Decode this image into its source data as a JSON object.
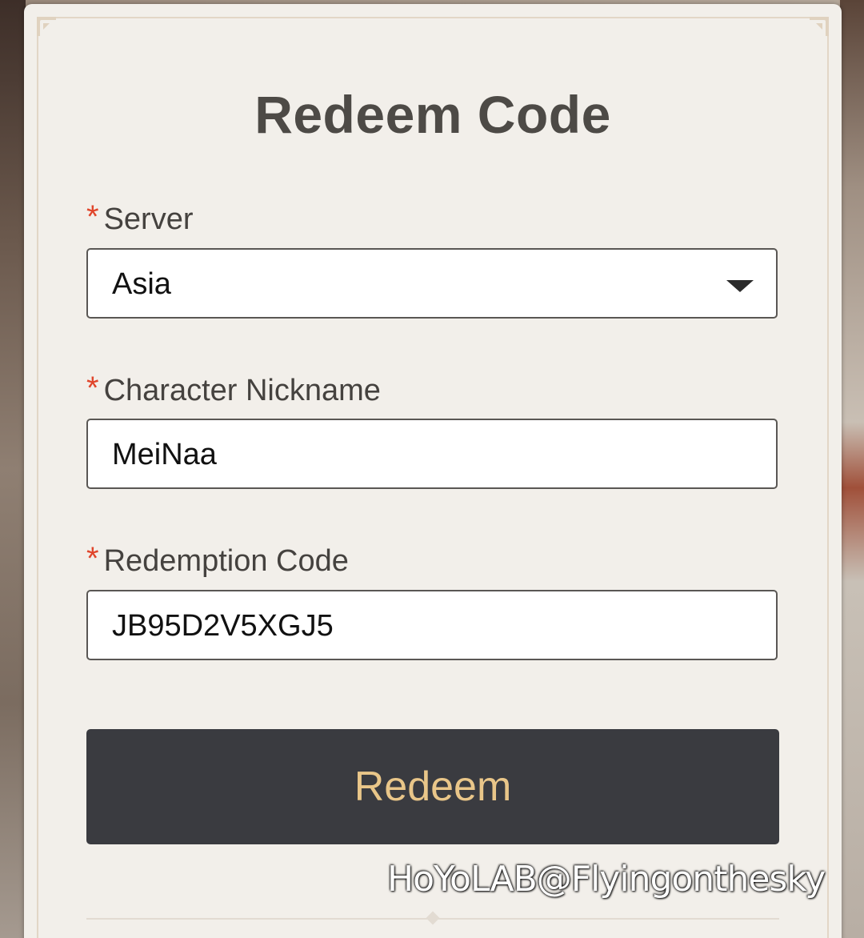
{
  "dialog": {
    "title": "Redeem Code"
  },
  "fields": {
    "server": {
      "required_mark": "*",
      "label": "Server",
      "value": "Asia"
    },
    "nickname": {
      "required_mark": "*",
      "label": "Character Nickname",
      "value": "MeiNaa"
    },
    "code": {
      "required_mark": "*",
      "label": "Redemption Code",
      "value": "JB95D2V5XGJ5"
    }
  },
  "actions": {
    "redeem_label": "Redeem"
  },
  "watermark": {
    "text": "HoYoLAB@Flyingonthesky"
  },
  "colors": {
    "button_bg": "#3a3b40",
    "button_text": "#e9c689",
    "required_mark": "#e0452b",
    "card_bg": "#f2efea"
  }
}
